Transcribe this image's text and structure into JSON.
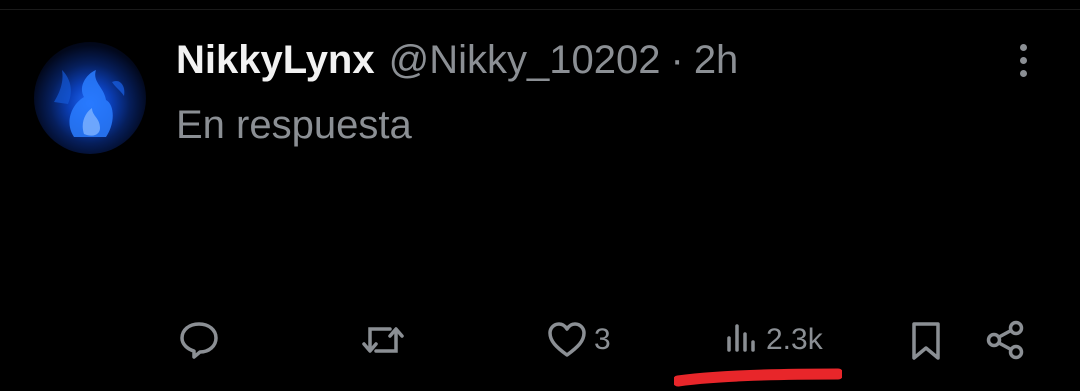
{
  "post": {
    "display_name": "NikkyLynx",
    "handle": "@Nikky_10202",
    "separator": "·",
    "time": "2h",
    "text": "En respuesta"
  },
  "actions": {
    "likes_count": "3",
    "views_count": "2.3k"
  },
  "icons": {
    "reply": "reply-icon",
    "repost": "repost-icon",
    "like": "heart-icon",
    "views": "views-chart-icon",
    "bookmark": "bookmark-icon",
    "share": "share-icon",
    "more": "more-vertical-icon"
  },
  "colors": {
    "background": "#000000",
    "primary_text": "#f2f2f2",
    "secondary_text": "#8b8f94",
    "annotation": "#e8262a",
    "avatar_accent": "#1e6bff"
  }
}
